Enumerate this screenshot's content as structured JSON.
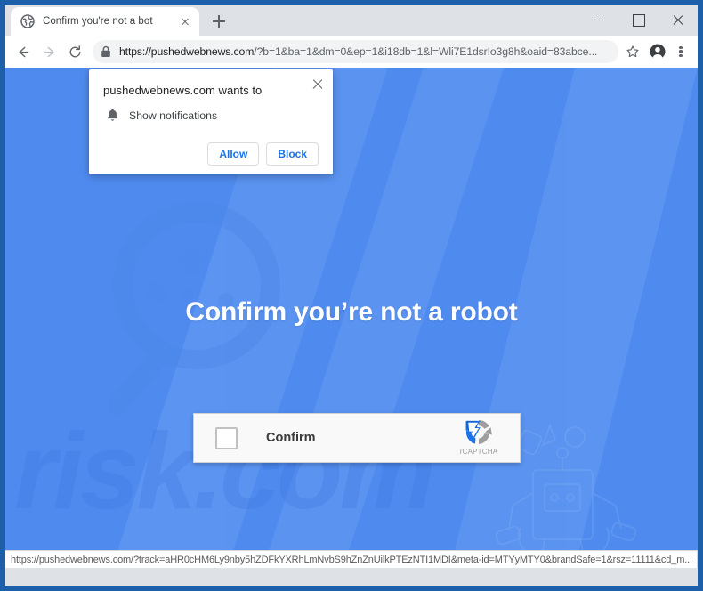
{
  "window": {
    "controls": {
      "minimize_label": "Minimize",
      "maximize_label": "Maximize",
      "close_label": "Close"
    }
  },
  "tabstrip": {
    "tab": {
      "title": "Confirm you're not a bot",
      "favicon": "globe-icon",
      "close_label": "Close tab"
    },
    "new_tab_label": "New tab"
  },
  "toolbar": {
    "back_label": "Back",
    "forward_label": "Forward",
    "reload_label": "Reload",
    "security_icon": "lock-icon",
    "url_host": "https://pushedwebnews.com",
    "url_query": "/?b=1&ba=1&dm=0&ep=1&i18db=1&l=Wli7E1dsrIo3g8h&oaid=83abce...",
    "bookmark_label": "Bookmark this page",
    "profile_label": "Profile",
    "menu_label": "Customize and control Google Chrome"
  },
  "permission_bubble": {
    "title": "pushedwebnews.com wants to",
    "request_icon": "bell-icon",
    "request_label": "Show notifications",
    "allow_label": "Allow",
    "block_label": "Block",
    "close_label": "Close"
  },
  "page": {
    "headline": "Confirm you’re not a robot",
    "captcha": {
      "checkbox_label": "Confirm",
      "brand_name": "rCAPTCHA",
      "brand_icon": "recaptcha-arrows-icon"
    },
    "background": {
      "watermark": "PCrisk.com",
      "art": "magnifier-and-robot-line-art"
    }
  },
  "statusbar": {
    "url": "https://pushedwebnews.com/?track=aHR0cHM6Ly9nby5hZDFkYXRhLmNvbS9hZnZnUilkPTEzNTI1MDI&meta-id=MTYyMTY0&brandSafe=1&rsz=11111&cd_m..."
  },
  "colors": {
    "page_background": "#4f8bef",
    "window_frame": "#1d5fa8",
    "chrome_toolbar": "#ffffff",
    "tabstrip": "#dee1e6",
    "omnibox": "#f1f3f4",
    "accent_blue": "#1a73e8",
    "captcha_box": "#f9f9f9"
  }
}
